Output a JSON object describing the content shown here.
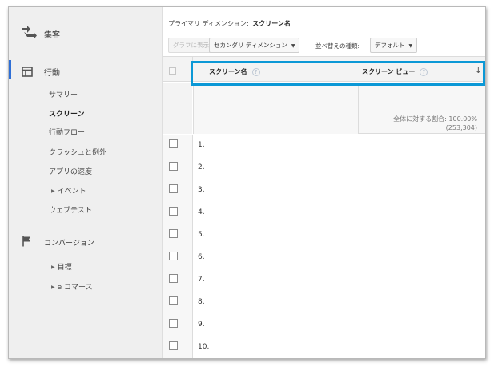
{
  "sidebar": {
    "acquisition": {
      "label": "集客",
      "icon": "acquisition-arrows-icon"
    },
    "behavior": {
      "label": "行動",
      "icon": "behavior-layout-icon"
    },
    "behavior_items": [
      {
        "label": "サマリー",
        "active": false,
        "caret": false
      },
      {
        "label": "スクリーン",
        "active": true,
        "caret": false
      },
      {
        "label": "行動フロー",
        "active": false,
        "caret": false
      },
      {
        "label": "クラッシュと例外",
        "active": false,
        "caret": false
      },
      {
        "label": "アプリの速度",
        "active": false,
        "caret": false
      },
      {
        "label": "イベント",
        "active": false,
        "caret": true
      },
      {
        "label": "ウェブテスト",
        "active": false,
        "caret": false
      }
    ],
    "conversions": {
      "label": "コンバージョン",
      "icon": "flag-icon"
    },
    "conversion_items": [
      {
        "label": "目標",
        "caret": true
      },
      {
        "label": "e コマース",
        "caret": true
      }
    ]
  },
  "main": {
    "primary_dimension_label": "プライマリ ディメンション:",
    "primary_dimension_value": "スクリーン名",
    "toolbar": {
      "plot_rows": "グラフに表示",
      "secondary_dimension": "セカンダリ ディメンション",
      "sort_type_label": "並べ替えの種類:",
      "sort_type_value": "デフォルト"
    },
    "table": {
      "col_name": "スクリーン名",
      "col_views": "スクリーン ビュー",
      "help": "?",
      "sort_arrow": "↓",
      "summary_pct": "全体に対する割合: 100.00%",
      "summary_total": "(253,304)",
      "rows": [
        "1.",
        "2.",
        "3.",
        "4.",
        "5.",
        "6.",
        "7.",
        "8.",
        "9.",
        "10."
      ]
    }
  },
  "colors": {
    "highlight": "#0b98d6",
    "active_bar": "#2f6fd6"
  }
}
